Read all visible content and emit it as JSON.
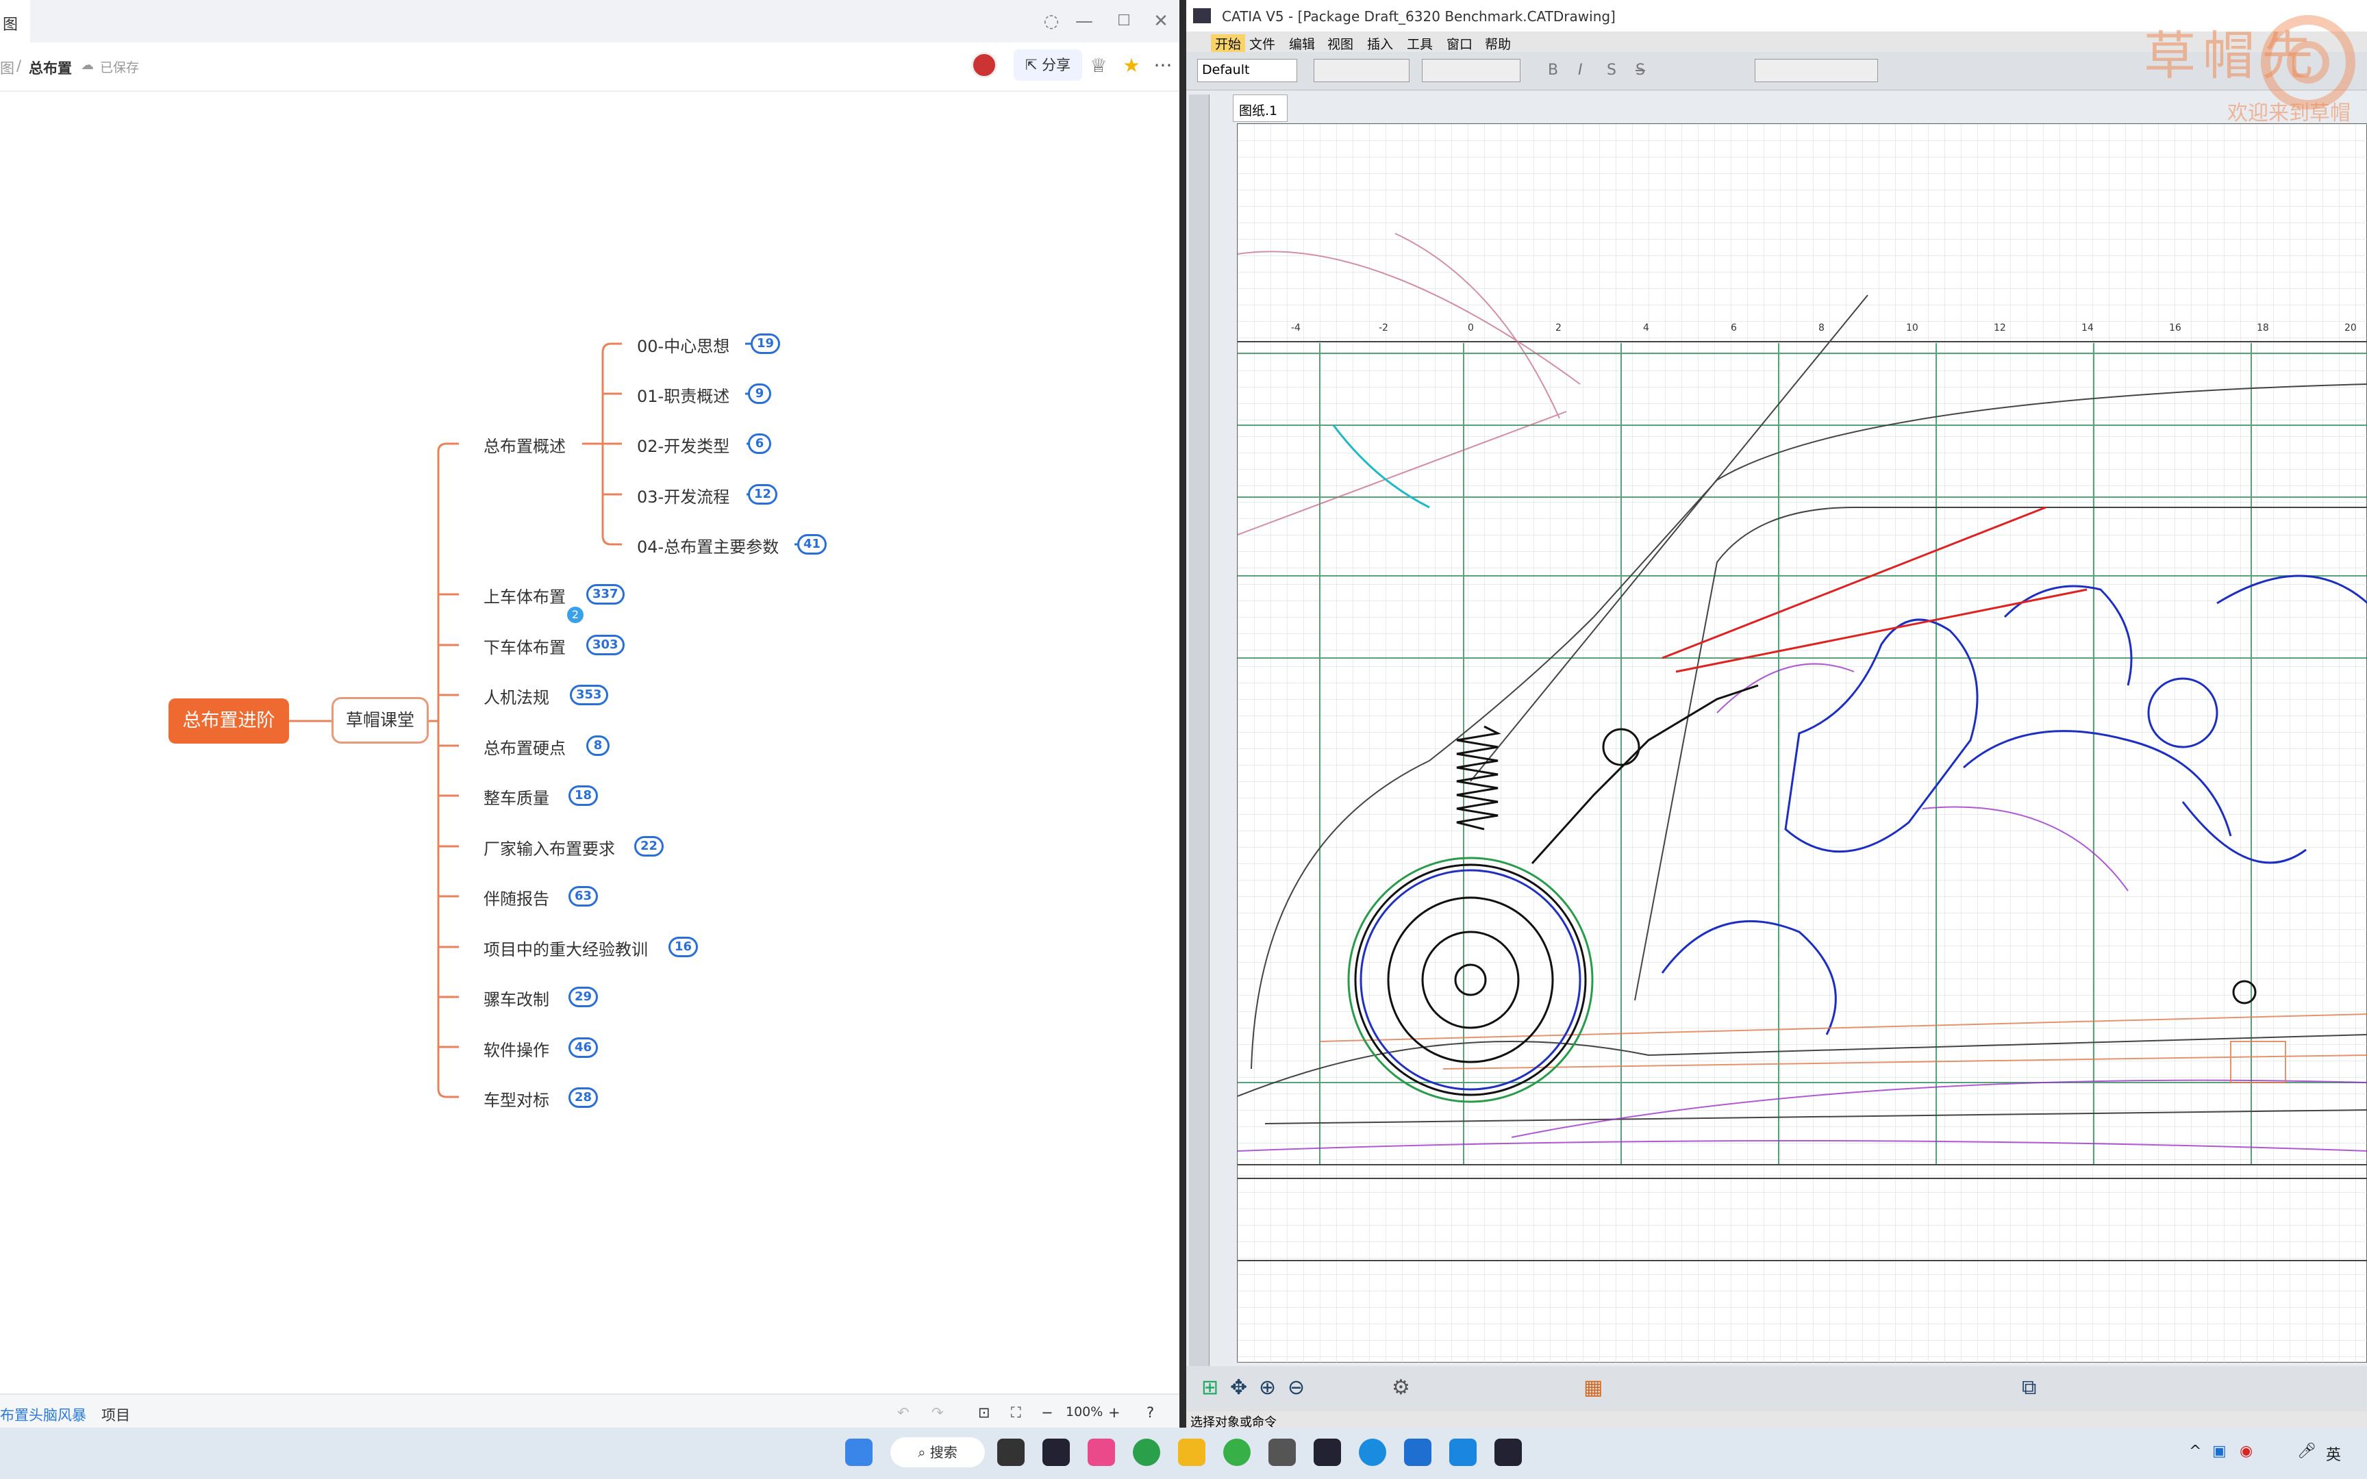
{
  "left_window": {
    "tab_char": "图",
    "breadcrumb": {
      "parent": "图",
      "sep": "/",
      "current": "总布置",
      "saved": "已保存"
    },
    "share_label": "分享",
    "more_label": "···",
    "bottom_tabs": [
      "布置头脑风暴",
      "项目"
    ],
    "zoom": "100%",
    "zoom_minus": "−",
    "zoom_plus": "+"
  },
  "mindmap": {
    "root": "总布置进阶",
    "sub": "草帽课堂",
    "overview": {
      "label": "总布置概述",
      "children": [
        {
          "label": "00-中心思想",
          "count": "19"
        },
        {
          "label": "01-职责概述",
          "count": "9"
        },
        {
          "label": "02-开发类型",
          "count": "6"
        },
        {
          "label": "03-开发流程",
          "count": "12"
        },
        {
          "label": "04-总布置主要参数",
          "count": "41"
        }
      ]
    },
    "branches": [
      {
        "label": "上车体布置",
        "count": "337"
      },
      {
        "label": "下车体布置",
        "count": "303"
      },
      {
        "label": "人机法规",
        "count": "353"
      },
      {
        "label": "总布置硬点",
        "count": "8"
      },
      {
        "label": "整车质量",
        "count": "18"
      },
      {
        "label": "厂家输入布置要求",
        "count": "22"
      },
      {
        "label": "伴随报告",
        "count": "63"
      },
      {
        "label": "项目中的重大经验教训",
        "count": "16"
      },
      {
        "label": "骡车改制",
        "count": "29"
      },
      {
        "label": "软件操作",
        "count": "46"
      },
      {
        "label": "车型对标",
        "count": "28"
      }
    ],
    "comment_count": "2"
  },
  "catia": {
    "title": "CATIA V5 - [Package Draft_6320 Benchmark.CATDrawing]",
    "menu": [
      "开始",
      "文件",
      "编辑",
      "视图",
      "插入",
      "工具",
      "窗口",
      "帮助"
    ],
    "style_combo": "Default",
    "sheet_tab": "图纸.1",
    "status": "选择对象或命令",
    "watermark": "草帽先",
    "watermark_sub": "欢迎来到草帽",
    "axis_ticks": [
      "-4",
      "-2",
      "0",
      "2",
      "4",
      "6",
      "8",
      "10",
      "12",
      "14",
      "16",
      "18",
      "20"
    ]
  },
  "taskbar": {
    "search": "搜索",
    "ime": "英"
  },
  "colors": {
    "root": "#ee6a30",
    "badge": "#2a6fd6",
    "branch_line": "#e8825a"
  }
}
